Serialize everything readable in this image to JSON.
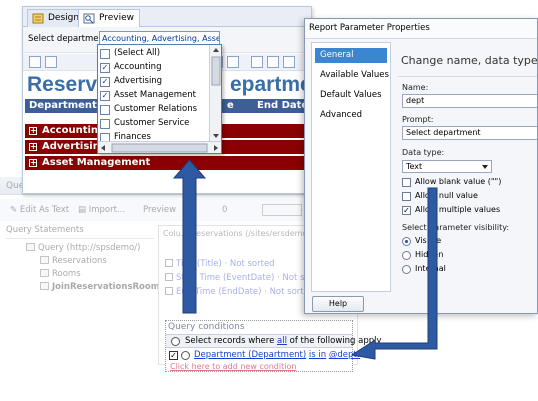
{
  "report": {
    "tabs": [
      "Design",
      "Preview"
    ],
    "param_label": "Select department",
    "param_value": "Accounting, Advertising, Asset",
    "title_left": "Reservat",
    "title_right": "epartment",
    "headers": [
      "Department",
      "e",
      "End Date"
    ],
    "groups": [
      "Accounting",
      "Advertising",
      "Asset Management"
    ]
  },
  "dropdown": {
    "items": [
      {
        "label": "(Select All)",
        "checked": false
      },
      {
        "label": "Accounting",
        "checked": true
      },
      {
        "label": "Advertising",
        "checked": true
      },
      {
        "label": "Asset Management",
        "checked": true
      },
      {
        "label": "Customer Relations",
        "checked": false
      },
      {
        "label": "Customer Service",
        "checked": false
      },
      {
        "label": "Finances",
        "checked": false
      }
    ]
  },
  "query": {
    "window_title": "Query Designer",
    "toolbar": {
      "edit_as_text": "Edit As Text",
      "import": "Import...",
      "preview": "Preview",
      "zero": "0"
    },
    "tree_head": "Query Statements",
    "tree": [
      "Query (http://spsdemo/)",
      "Reservations",
      "Rooms",
      "JoinReservationsRooms"
    ],
    "cols_head": "Colu... Reservations (/sites/ersdemo...",
    "cols": [
      {
        "name": "Title (Title)",
        "sort": "Not sorted"
      },
      {
        "name": "Start Time (EventDate)",
        "sort": "Not sorted"
      },
      {
        "name": "End Time (EndDate)",
        "sort": "Not sorted"
      }
    ],
    "conditions": {
      "title": "Query conditions",
      "header_pre": "Select records where",
      "header_link": "all",
      "header_post": "of the following apply",
      "field": "Department (Department)",
      "op": "is in",
      "value": "@dept!",
      "add": "Click here to add new condition"
    }
  },
  "dialog": {
    "title": "Report Parameter Properties",
    "nav": [
      "General",
      "Available Values",
      "Default Values",
      "Advanced"
    ],
    "heading": "Change name, data type, and oth",
    "name_label": "Name:",
    "name_value": "dept",
    "prompt_label": "Prompt:",
    "prompt_value": "Select department",
    "datatype_label": "Data type:",
    "datatype_value": "Text",
    "checks": [
      {
        "label": "Allow blank value (\"\")",
        "checked": false
      },
      {
        "label": "Allow null value",
        "checked": false
      },
      {
        "label": "Allow multiple values",
        "checked": true
      }
    ],
    "visibility_label": "Select parameter visibility:",
    "visibility": [
      {
        "label": "Visible",
        "selected": true
      },
      {
        "label": "Hidden",
        "selected": false
      },
      {
        "label": "Internal",
        "selected": false
      }
    ],
    "help": "Help"
  },
  "colors": {
    "group_row": "#8b0000",
    "header_row": "#3d5f96",
    "title_blue": "#3a6ea8",
    "arrow_blue": "#2d5aa3",
    "nav_selected": "#3a86d0"
  }
}
